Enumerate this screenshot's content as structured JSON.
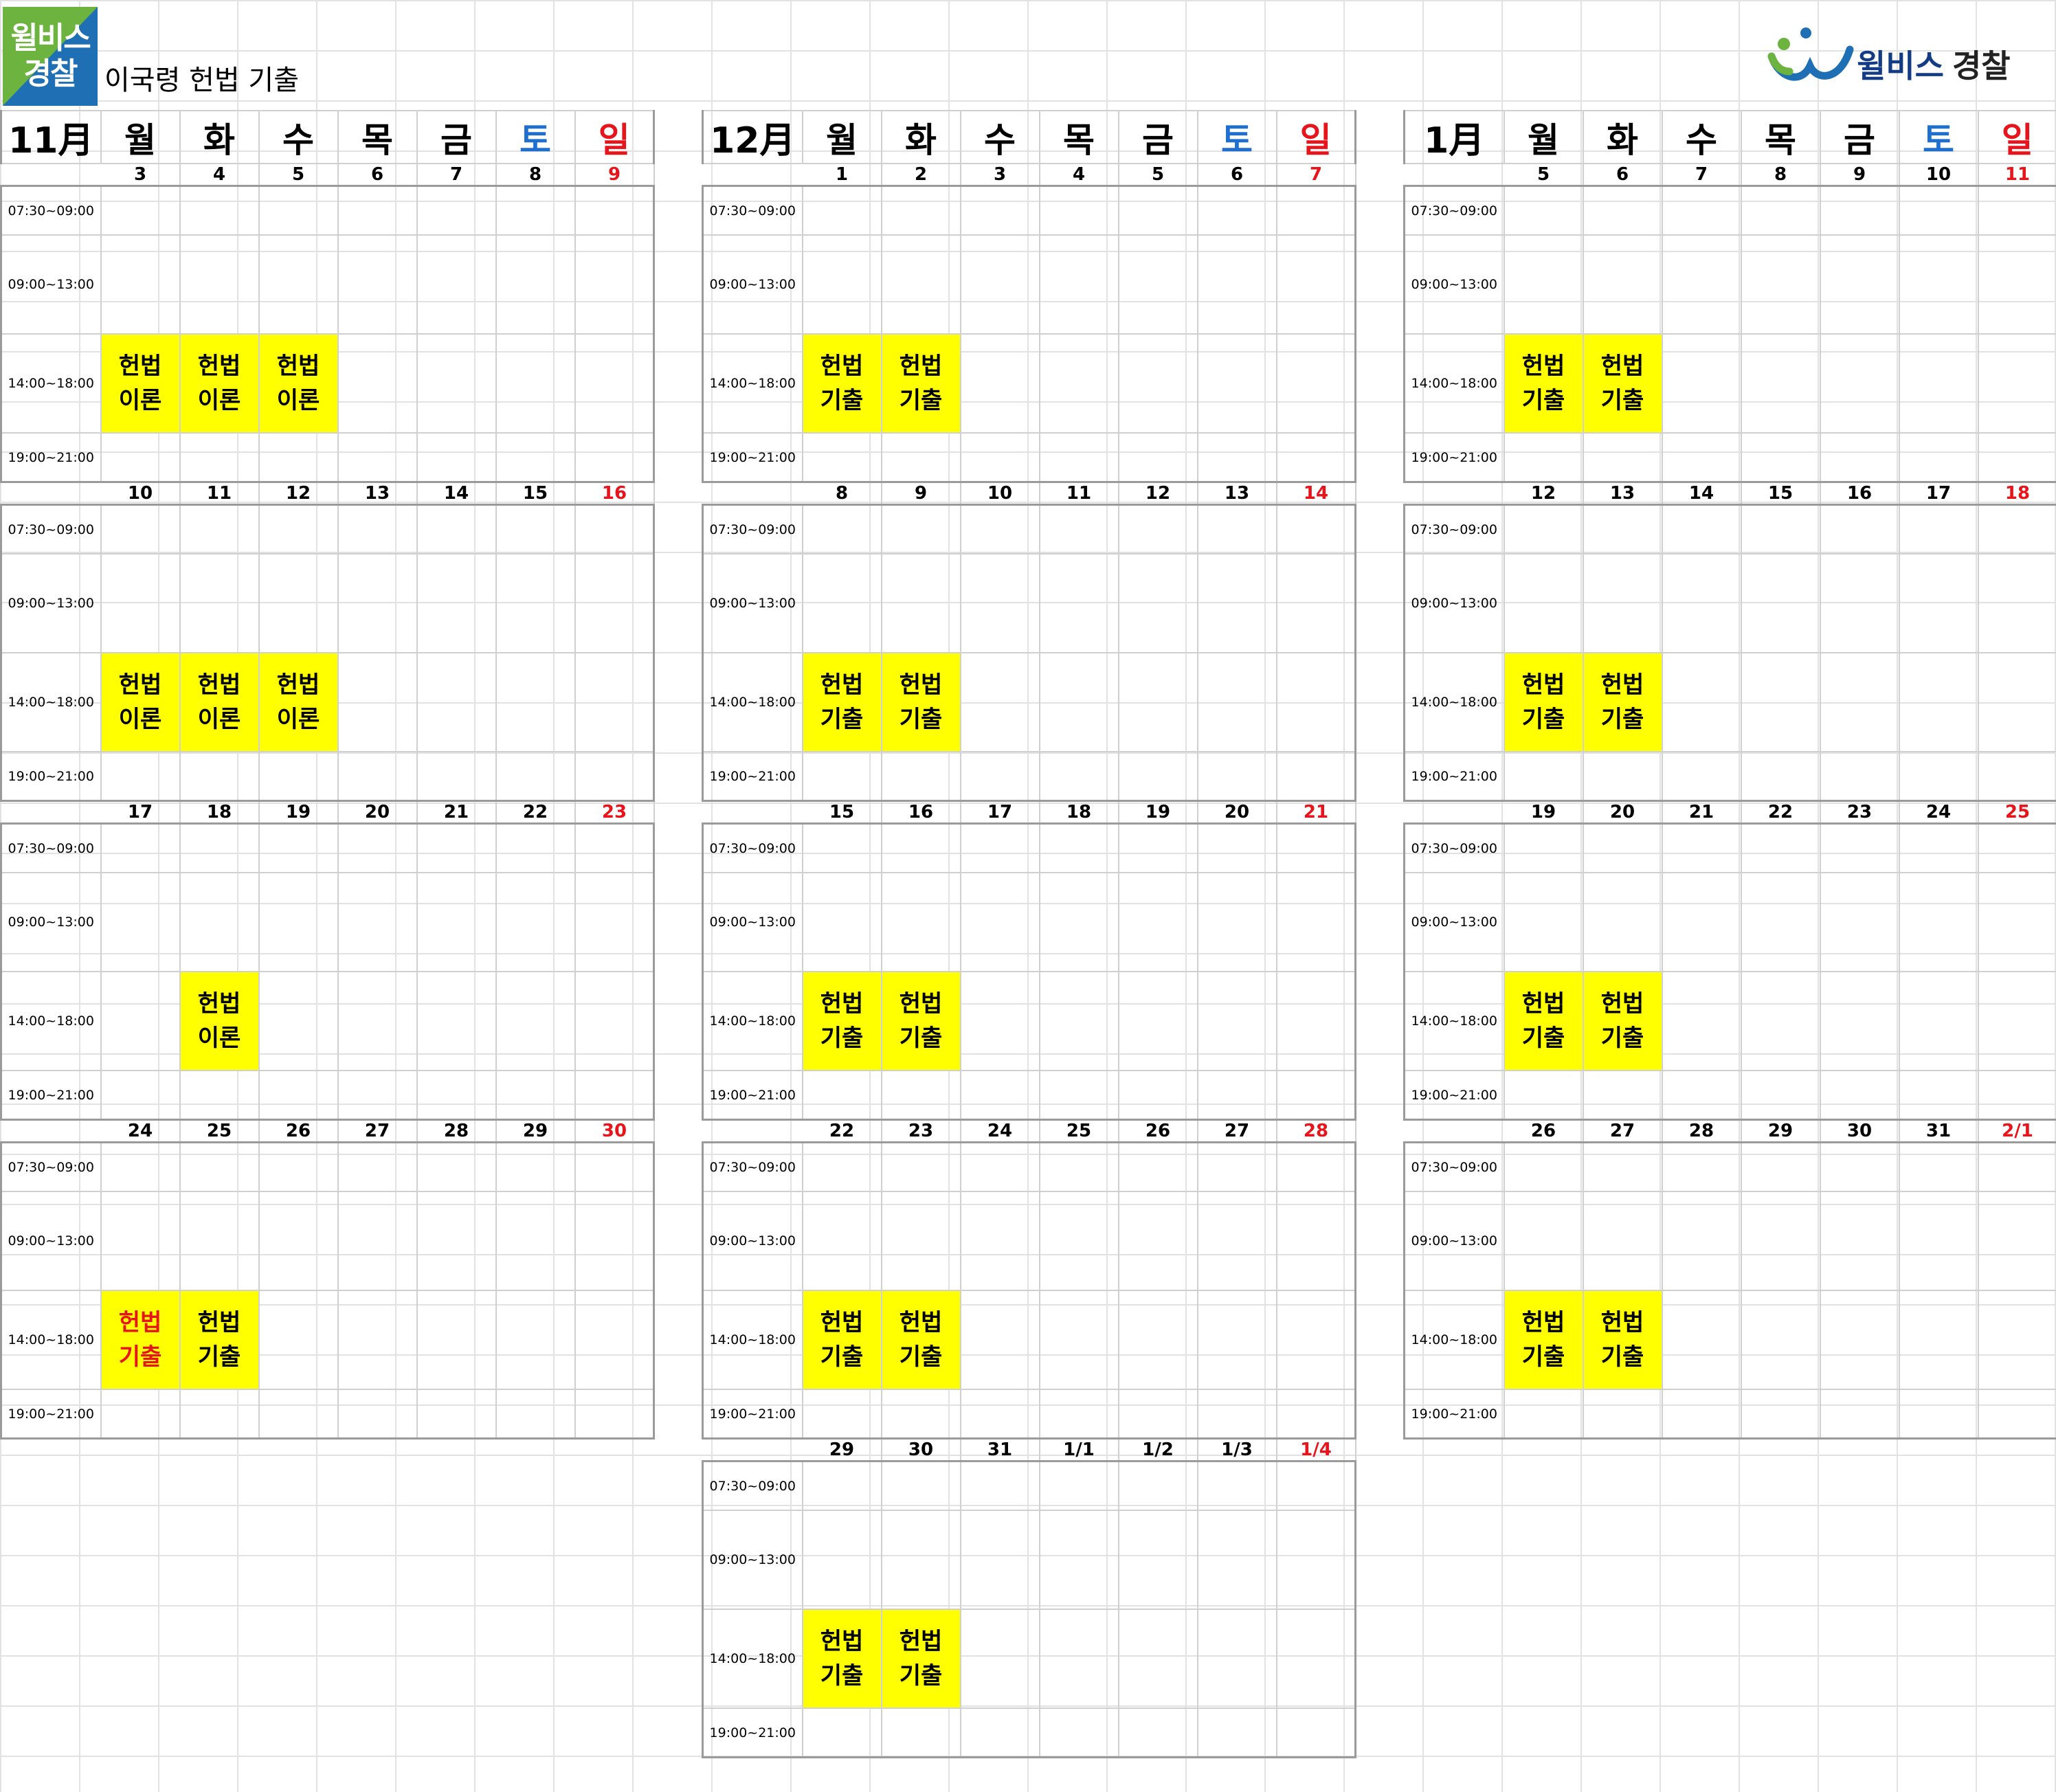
{
  "logo": {
    "line1": "윌비스",
    "line2": "경찰"
  },
  "title": "이국령 헌법 기출",
  "brand": {
    "name_blue": "윌비스",
    "name_dark": "경찰"
  },
  "colors": {
    "highlight": "#ffff00",
    "saturday": "#1f6fd0",
    "sunday": "#e8141b",
    "brand_blue": "#143c85"
  },
  "weekdays": [
    "월",
    "화",
    "수",
    "목",
    "금",
    "토",
    "일"
  ],
  "time_slots": [
    "07:30~09:00",
    "09:00~13:00",
    "14:00~18:00",
    "19:00~21:00"
  ],
  "calendars": [
    {
      "month": "11月",
      "weeks": [
        {
          "dates": [
            "3",
            "4",
            "5",
            "6",
            "7",
            "8",
            "9"
          ],
          "classes": [
            [
              "헌법",
              "이론"
            ],
            [
              "헌법",
              "이론"
            ],
            [
              "헌법",
              "이론"
            ],
            null,
            null,
            null,
            null
          ]
        },
        {
          "dates": [
            "10",
            "11",
            "12",
            "13",
            "14",
            "15",
            "16"
          ],
          "classes": [
            [
              "헌법",
              "이론"
            ],
            [
              "헌법",
              "이론"
            ],
            [
              "헌법",
              "이론"
            ],
            null,
            null,
            null,
            null
          ]
        },
        {
          "dates": [
            "17",
            "18",
            "19",
            "20",
            "21",
            "22",
            "23"
          ],
          "classes": [
            null,
            [
              "헌법",
              "이론"
            ],
            null,
            null,
            null,
            null,
            null
          ]
        },
        {
          "dates": [
            "24",
            "25",
            "26",
            "27",
            "28",
            "29",
            "30"
          ],
          "classes": [
            [
              "헌법",
              "기출"
            ],
            [
              "헌법",
              "기출"
            ],
            null,
            null,
            null,
            null,
            null
          ]
        }
      ]
    },
    {
      "month": "12月",
      "weeks": [
        {
          "dates": [
            "1",
            "2",
            "3",
            "4",
            "5",
            "6",
            "7"
          ],
          "classes": [
            [
              "헌법",
              "기출"
            ],
            [
              "헌법",
              "기출"
            ],
            null,
            null,
            null,
            null,
            null
          ]
        },
        {
          "dates": [
            "8",
            "9",
            "10",
            "11",
            "12",
            "13",
            "14"
          ],
          "classes": [
            [
              "헌법",
              "기출"
            ],
            [
              "헌법",
              "기출"
            ],
            null,
            null,
            null,
            null,
            null
          ]
        },
        {
          "dates": [
            "15",
            "16",
            "17",
            "18",
            "19",
            "20",
            "21"
          ],
          "classes": [
            [
              "헌법",
              "기출"
            ],
            [
              "헌법",
              "기출"
            ],
            null,
            null,
            null,
            null,
            null
          ]
        },
        {
          "dates": [
            "22",
            "23",
            "24",
            "25",
            "26",
            "27",
            "28"
          ],
          "classes": [
            [
              "헌법",
              "기출"
            ],
            [
              "헌법",
              "기출"
            ],
            null,
            null,
            null,
            null,
            null
          ]
        },
        {
          "dates": [
            "29",
            "30",
            "31",
            "1/1",
            "1/2",
            "1/3",
            "1/4"
          ],
          "classes": [
            [
              "헌법",
              "기출"
            ],
            [
              "헌법",
              "기출"
            ],
            null,
            null,
            null,
            null,
            null
          ]
        }
      ]
    },
    {
      "month": "1月",
      "weeks": [
        {
          "dates": [
            "5",
            "6",
            "7",
            "8",
            "9",
            "10",
            "11"
          ],
          "classes": [
            [
              "헌법",
              "기출"
            ],
            [
              "헌법",
              "기출"
            ],
            null,
            null,
            null,
            null,
            null
          ]
        },
        {
          "dates": [
            "12",
            "13",
            "14",
            "15",
            "16",
            "17",
            "18"
          ],
          "classes": [
            [
              "헌법",
              "기출"
            ],
            [
              "헌법",
              "기출"
            ],
            null,
            null,
            null,
            null,
            null
          ]
        },
        {
          "dates": [
            "19",
            "20",
            "21",
            "22",
            "23",
            "24",
            "25"
          ],
          "classes": [
            [
              "헌법",
              "기출"
            ],
            [
              "헌법",
              "기출"
            ],
            null,
            null,
            null,
            null,
            null
          ]
        },
        {
          "dates": [
            "26",
            "27",
            "28",
            "29",
            "30",
            "31",
            "2/1"
          ],
          "classes": [
            [
              "헌법",
              "기출"
            ],
            [
              "헌법",
              "기출"
            ],
            null,
            null,
            null,
            null,
            null
          ]
        }
      ]
    }
  ],
  "red_text_cells": [
    "0-3-0"
  ]
}
